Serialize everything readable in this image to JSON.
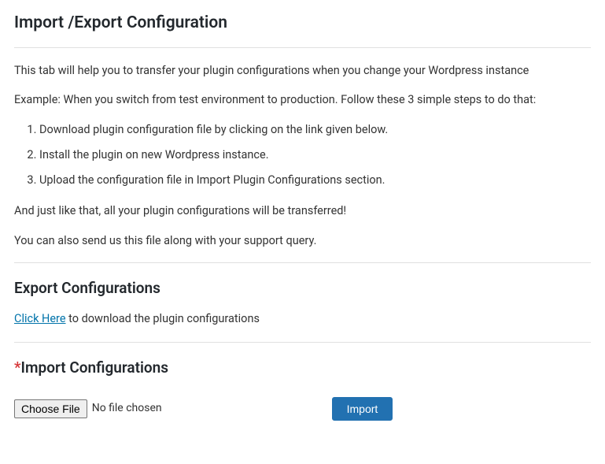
{
  "page": {
    "title": "Import /Export Configuration",
    "intro1": "This tab will help you to transfer your plugin configurations when you change your Wordpress instance",
    "intro2": "Example: When you switch from test environment to production. Follow these 3 simple steps to do that:",
    "steps": [
      "Download plugin configuration file by clicking on the link given below.",
      "Install the plugin on new Wordpress instance.",
      "Upload the configuration file in Import Plugin Configurations section."
    ],
    "outro1": "And just like that, all your plugin configurations will be transferred!",
    "outro2": "You can also send us this file along with your support query."
  },
  "export": {
    "heading": "Export Configurations",
    "link_text": "Click Here",
    "link_suffix": " to download the plugin configurations"
  },
  "import": {
    "required_mark": "*",
    "heading": "Import Configurations",
    "choose_button": "Choose File",
    "no_file_text": "No file chosen",
    "submit_button": "Import"
  }
}
